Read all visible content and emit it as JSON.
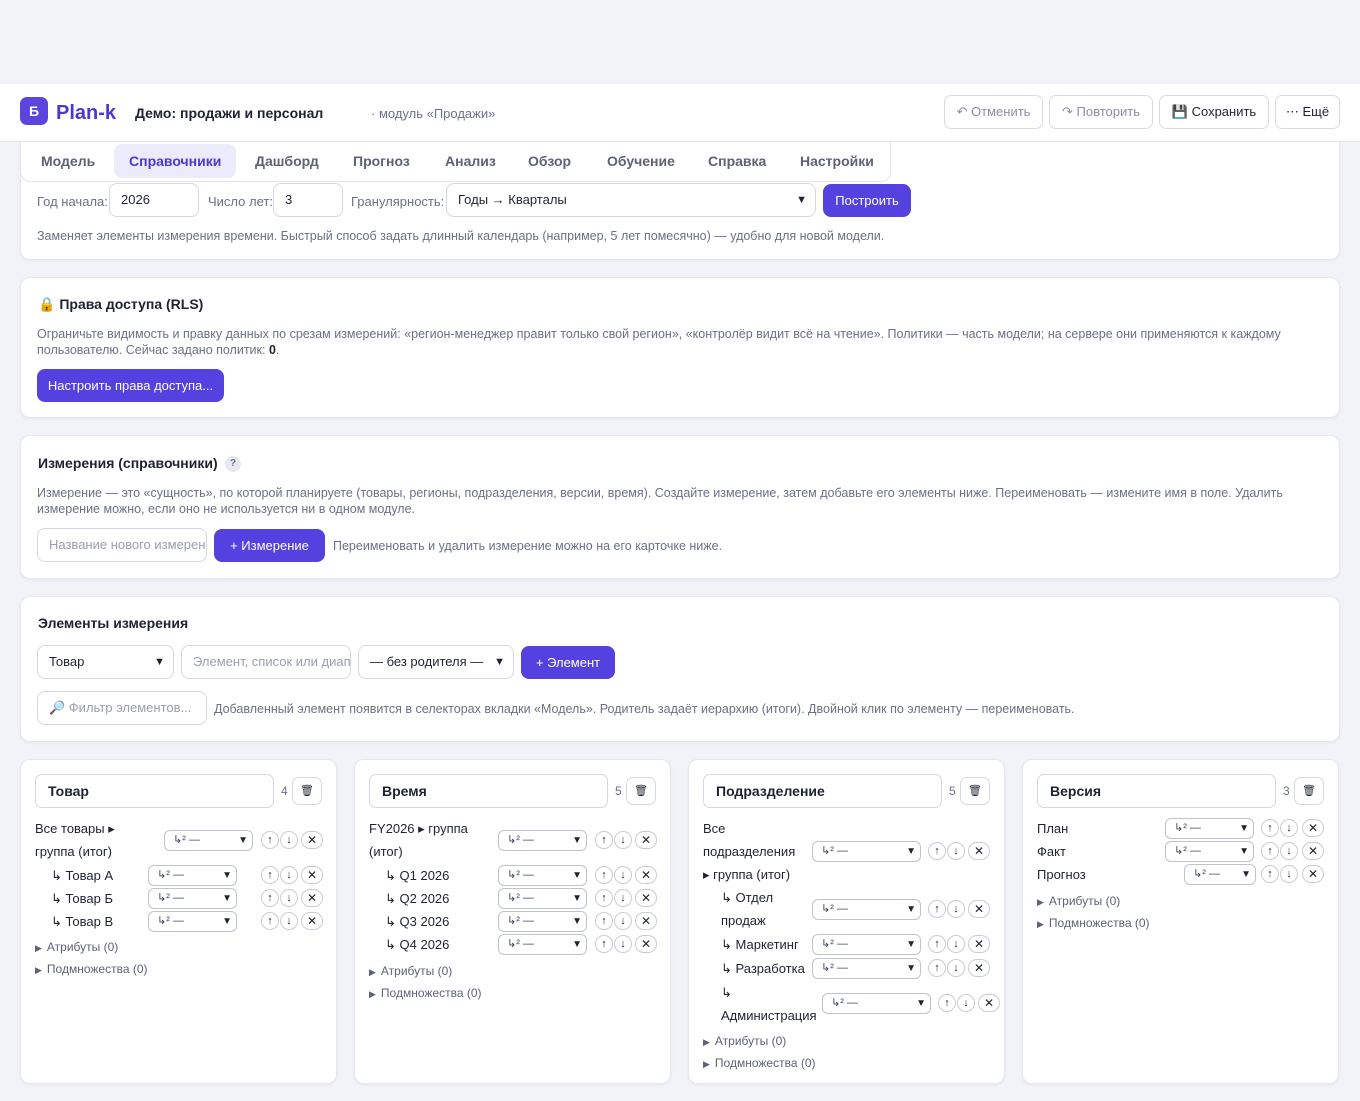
{
  "app": {
    "logo_glyph": "Б",
    "name": "Plan-k",
    "title": "Демо: продажи и персонал",
    "module": "· модуль «Продажи»"
  },
  "actions": {
    "undo": "↶ Отменить",
    "redo": "↷ Повторить",
    "save": "💾 Сохранить",
    "more": "⋯ Ещё"
  },
  "tabs": [
    "Модель",
    "Справочники",
    "Дашборд",
    "Прогноз",
    "Анализ",
    "Обзор",
    "Обучение",
    "Справка",
    "Настройки"
  ],
  "time_gen": {
    "start_year_label": "Год начала:",
    "start_year": "2026",
    "years_label": "Число лет:",
    "years": "3",
    "granularity_label": "Гранулярность:",
    "granularity": "Годы → Кварталы",
    "build": "Построить",
    "note": "Заменяет элементы измерения времени. Быстрый способ задать длинный календарь (например, 5 лет помесячно) — удобно для новой модели."
  },
  "rls": {
    "title": "Права доступа (RLS)",
    "note": "Ограничьте видимость и правку данных по срезам измерений: «регион-менеджер правит только свой регион», «контролёр видит всё на чтение». Политики — часть модели; на сервере они применяются к каждому",
    "note2_prefix": "пользователю. Сейчас задано политик: ",
    "count": "0",
    "note2_suffix": ".",
    "button": "Настроить права доступа..."
  },
  "dims": {
    "title": "Измерения (справочники)",
    "help": "?",
    "note": "Измерение — это «сущность», по которой планируете (товары, регионы, подразделения, версии, время). Создайте измерение, затем добавьте его элементы ниже. Переименовать — измените имя в поле. Удалить",
    "note2": "измерение можно, если оно не используется ни в одном модуле.",
    "placeholder": "Название нового измерения",
    "add": "+ Измерение",
    "hint": "Переименовать и удалить измерение можно на его карточке ниже."
  },
  "elements": {
    "title": "Элементы измерения",
    "dim_select": "Товар",
    "placeholder": "Элемент, список или диапазон",
    "parent_select": "— без родителя —",
    "add": "+ Элемент",
    "filter_placeholder": "🔎 Фильтр элементов...",
    "hint": "Добавленный элемент появится в селекторах вкладки «Модель». Родитель задаёт иерархию (итоги). Двойной клик по элементу — переименовать."
  },
  "row_ui": {
    "parent": "↳² —",
    "up": "↑",
    "down": "↓",
    "del": "✕",
    "trash": "🗑",
    "attrs": "Атрибуты (0)",
    "subsets": "Подмножества (0)"
  },
  "cards": [
    {
      "name": "Товар",
      "count": "4",
      "root": [
        "Все товары ▸",
        "группа (итог)"
      ],
      "items": [
        "↳ Товар А",
        "↳ Товар Б",
        "↳ Товар В"
      ]
    },
    {
      "name": "Время",
      "count": "5",
      "root": [
        "FY2026 ▸ группа",
        "(итог)"
      ],
      "items": [
        "↳ Q1 2026",
        "↳ Q2 2026",
        "↳ Q3 2026",
        "↳ Q4 2026"
      ]
    },
    {
      "name": "Подразделение",
      "count": "5",
      "root": [
        "Все",
        "подразделения",
        "▸ группа (итог)"
      ],
      "items": [
        [
          "↳ Отдел",
          "продаж"
        ],
        [
          "↳ Маркетинг"
        ],
        [
          "↳ Разработка"
        ],
        [
          "↳",
          "Администрация"
        ]
      ]
    },
    {
      "name": "Версия",
      "count": "3",
      "items": [
        "План",
        "Факт",
        "Прогноз"
      ]
    }
  ],
  "colors": {
    "accent": "#5541e0",
    "brand": "#4a3ad0",
    "background": "#f2f3f8"
  }
}
